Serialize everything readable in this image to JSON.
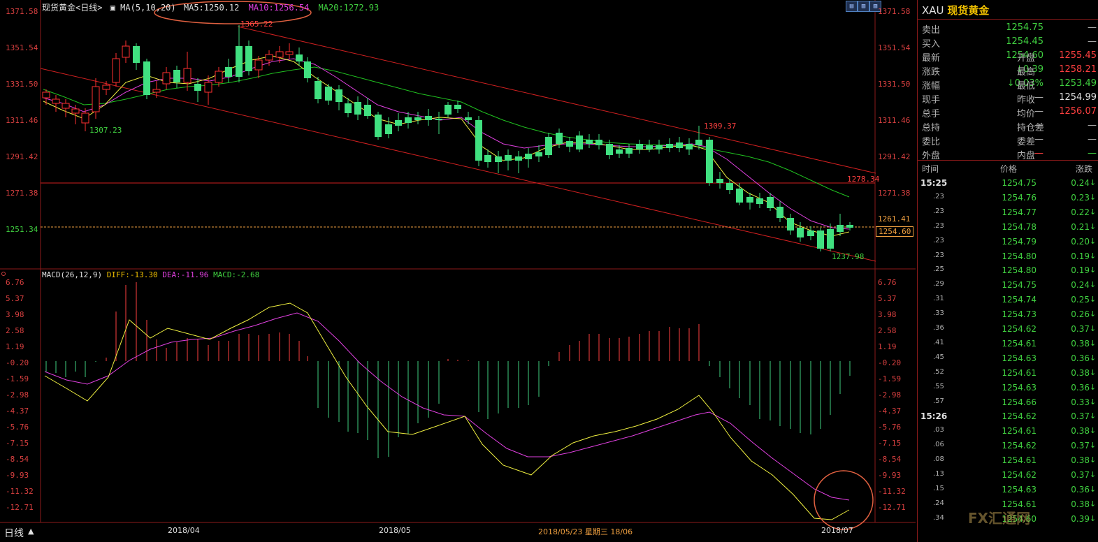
{
  "header": {
    "title": "现货黄金<日线>",
    "ma_label": "MA(5,10,20)",
    "ma5": "MA5:1250.12",
    "ma10": "MA10:1256.54",
    "ma20": "MA20:1272.93"
  },
  "price_axis": [
    "1371.58",
    "1351.54",
    "1331.50",
    "1311.46",
    "1291.42",
    "1271.38",
    "1251.34"
  ],
  "price_axis_right": [
    "1371.58",
    "1351.54",
    "1331.50",
    "1311.46",
    "1291.42",
    "1271.38"
  ],
  "annotations": {
    "high": "1365.22",
    "low_a": "1307.23",
    "mid_high": "1309.37",
    "level": "1278.34",
    "low_b": "1237.98",
    "ref": "1261.41",
    "last": "1254.60"
  },
  "macd_header": {
    "label": "MACD(26,12,9)",
    "diff": "DIFF:-13.30",
    "dea": "DEA:-11.96",
    "macd": "MACD:-2.68"
  },
  "macd_axis": [
    "6.76",
    "5.37",
    "3.98",
    "2.58",
    "1.19",
    "-0.20",
    "-1.59",
    "-2.98",
    "-4.37",
    "-5.76",
    "-7.15",
    "-8.54",
    "-9.93",
    "-11.32",
    "-12.71"
  ],
  "bottom": {
    "tab": "日线",
    "dates": [
      "2018/04",
      "2018/05",
      "2018/05/23 星期三 18/06",
      "2018/07"
    ]
  },
  "quote": {
    "symbol": "XAU",
    "name": "现货黄金",
    "rows": [
      {
        "l": "卖出",
        "v": "1254.75",
        "vc": "c-dn",
        "r": "",
        "rv": "—"
      },
      {
        "l": "买入",
        "v": "1254.45",
        "vc": "c-dn",
        "r": "",
        "rv": "—"
      },
      {
        "l": "最新",
        "v": "1254.60",
        "vc": "c-dn",
        "r": "开盘",
        "rv": "1255.45",
        "rvc": "c-up"
      },
      {
        "l": "涨跌",
        "v": "↓0.39",
        "vc": "c-dn",
        "r": "最高",
        "rv": "1258.21",
        "rvc": "c-up"
      },
      {
        "l": "涨幅",
        "v": "↓0.03%",
        "vc": "c-dn",
        "r": "最低",
        "rv": "1253.49",
        "rvc": "c-dn"
      },
      {
        "l": "现手",
        "v": "—",
        "vc": "c-lab",
        "r": "昨收",
        "rv": "1254.99",
        "rvc": "c-wht"
      },
      {
        "l": "总手",
        "v": "—",
        "vc": "c-lab",
        "r": "均价",
        "rv": "1256.07",
        "rvc": "c-up"
      },
      {
        "l": "总持",
        "v": "—",
        "vc": "c-lab",
        "r": "持仓差",
        "rv": "—",
        "rvc": "c-lab"
      },
      {
        "l": "委比",
        "v": "—",
        "vc": "c-lab",
        "r": "委差",
        "rv": "—",
        "rvc": "c-lab"
      },
      {
        "l": "外盘",
        "v": "—",
        "vc": "c-up",
        "r": "内盘",
        "rv": "—",
        "rvc": "c-dn"
      }
    ]
  },
  "ticks_header": {
    "time": "时间",
    "price": "价格",
    "change": "涨跌"
  },
  "ticks": [
    {
      "t": "15:25",
      "p": "1254.75",
      "c": "0.24"
    },
    {
      "t": ".23",
      "p": "1254.76",
      "c": "0.23"
    },
    {
      "t": ".23",
      "p": "1254.77",
      "c": "0.22"
    },
    {
      "t": ".23",
      "p": "1254.78",
      "c": "0.21"
    },
    {
      "t": ".23",
      "p": "1254.79",
      "c": "0.20"
    },
    {
      "t": ".23",
      "p": "1254.80",
      "c": "0.19"
    },
    {
      "t": ".25",
      "p": "1254.80",
      "c": "0.19"
    },
    {
      "t": ".29",
      "p": "1254.75",
      "c": "0.24"
    },
    {
      "t": ".31",
      "p": "1254.74",
      "c": "0.25"
    },
    {
      "t": ".33",
      "p": "1254.73",
      "c": "0.26"
    },
    {
      "t": ".36",
      "p": "1254.62",
      "c": "0.37"
    },
    {
      "t": ".41",
      "p": "1254.61",
      "c": "0.38"
    },
    {
      "t": ".45",
      "p": "1254.63",
      "c": "0.36"
    },
    {
      "t": ".52",
      "p": "1254.61",
      "c": "0.38"
    },
    {
      "t": ".55",
      "p": "1254.63",
      "c": "0.36"
    },
    {
      "t": ".57",
      "p": "1254.66",
      "c": "0.33"
    },
    {
      "t": "15:26",
      "p": "1254.62",
      "c": "0.37"
    },
    {
      "t": ".03",
      "p": "1254.61",
      "c": "0.38"
    },
    {
      "t": ".06",
      "p": "1254.62",
      "c": "0.37"
    },
    {
      "t": ".08",
      "p": "1254.61",
      "c": "0.38"
    },
    {
      "t": ".13",
      "p": "1254.62",
      "c": "0.37"
    },
    {
      "t": ".15",
      "p": "1254.63",
      "c": "0.36"
    },
    {
      "t": ".24",
      "p": "1254.61",
      "c": "0.38"
    },
    {
      "t": ".34",
      "p": "1254.60",
      "c": "0.39"
    }
  ],
  "watermark": "FX汇通网"
}
